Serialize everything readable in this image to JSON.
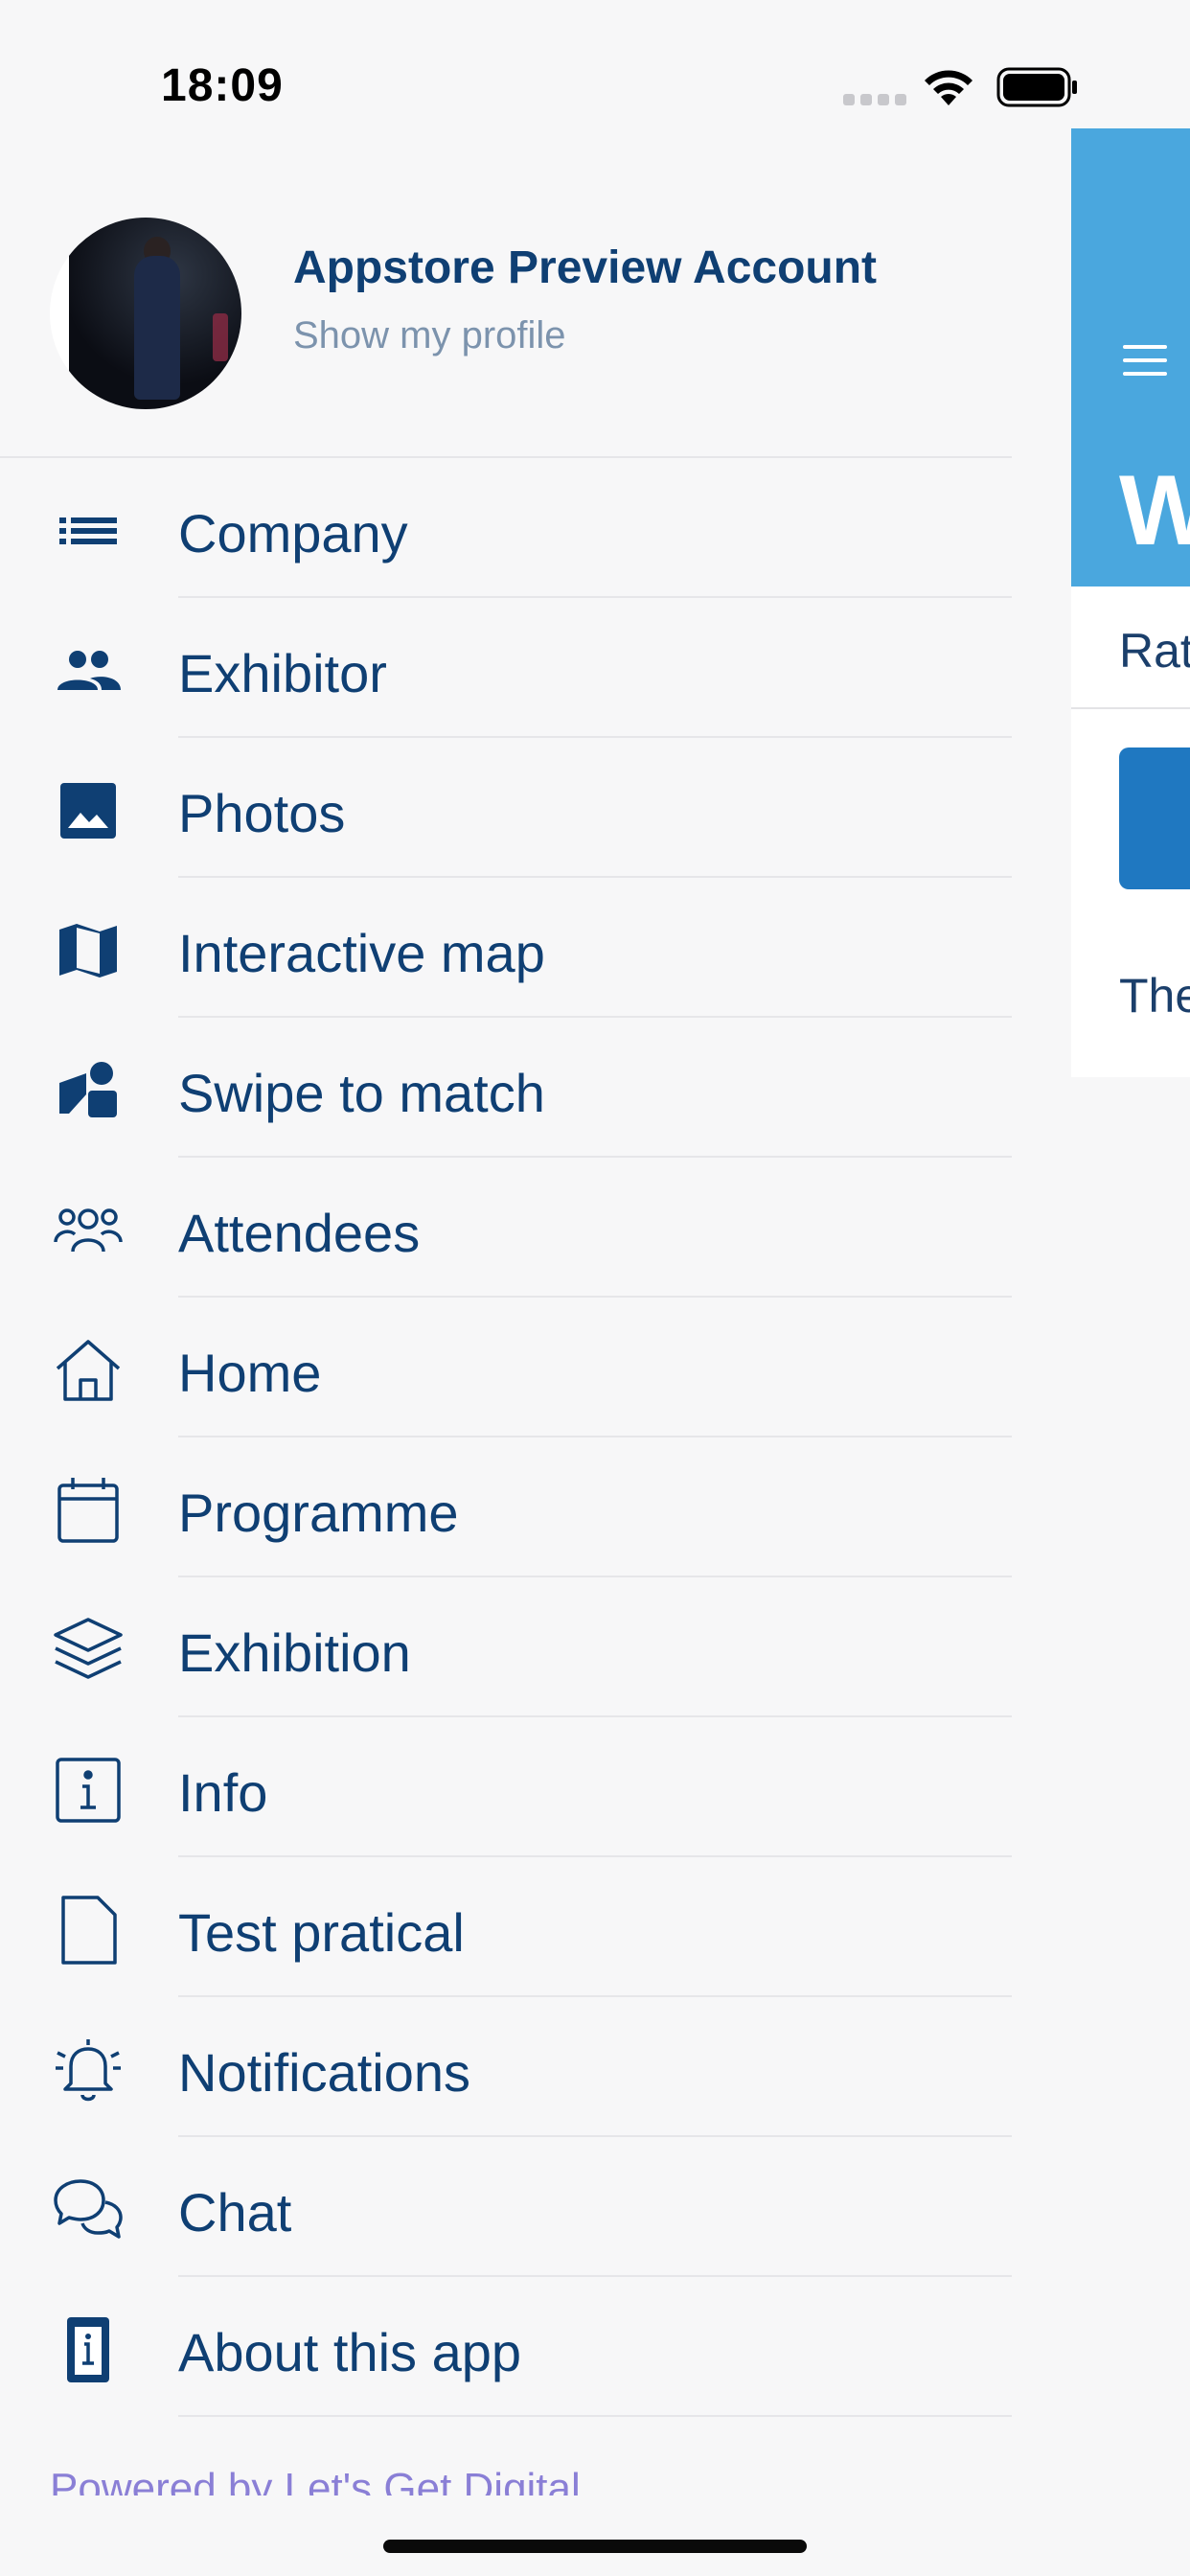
{
  "status_bar": {
    "time": "18:09"
  },
  "profile": {
    "name": "Appstore Preview Account",
    "subtitle": "Show my profile"
  },
  "menu": [
    {
      "label": "Company",
      "icon": "list-icon"
    },
    {
      "label": "Exhibitor",
      "icon": "people-icon"
    },
    {
      "label": "Photos",
      "icon": "photo-icon"
    },
    {
      "label": "Interactive map",
      "icon": "map-icon"
    },
    {
      "label": "Swipe to match",
      "icon": "swipe-match-icon"
    },
    {
      "label": "Attendees",
      "icon": "attendees-icon"
    },
    {
      "label": "Home",
      "icon": "home-icon"
    },
    {
      "label": "Programme",
      "icon": "calendar-icon"
    },
    {
      "label": "Exhibition",
      "icon": "layers-icon"
    },
    {
      "label": "Info",
      "icon": "info-icon"
    },
    {
      "label": "Test pratical",
      "icon": "document-icon"
    },
    {
      "label": "Notifications",
      "icon": "bell-icon"
    },
    {
      "label": "Chat",
      "icon": "chat-icon"
    },
    {
      "label": "About this app",
      "icon": "about-icon"
    }
  ],
  "footer": {
    "text": "Powered by Let's Get Digital"
  },
  "background_screen": {
    "title_fragment": "W",
    "tab_fragment": "Rat",
    "body_fragment": "The"
  },
  "colors": {
    "primary_text": "#0f3f73",
    "header_blue": "#4aa7de",
    "button_blue": "#1f78c1",
    "subtitle": "#7c93ad",
    "footer_link": "#8a7fd6"
  }
}
